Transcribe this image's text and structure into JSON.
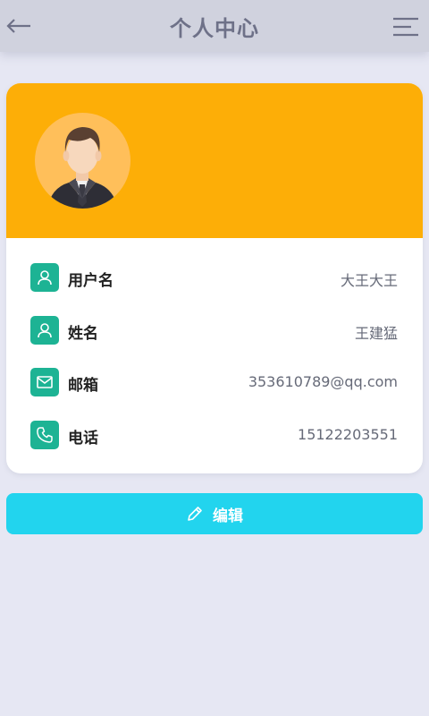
{
  "header": {
    "title": "个人中心",
    "back_icon": "arrow-left-icon",
    "menu_icon": "menu-icon"
  },
  "profile": {
    "banner_color": "#fdae07",
    "avatar_icon": "businessman-avatar",
    "fields": [
      {
        "icon": "user-icon",
        "label": "用户名",
        "value": "大王大王"
      },
      {
        "icon": "user-icon",
        "label": "姓名",
        "value": "王建猛"
      },
      {
        "icon": "mail-icon",
        "label": "邮箱",
        "value": "353610789@qq.com"
      },
      {
        "icon": "phone-icon",
        "label": "电话",
        "value": "15122203551"
      }
    ]
  },
  "actions": {
    "edit_label": "编辑",
    "edit_icon": "pencil-icon",
    "edit_color": "#22d4ee"
  },
  "colors": {
    "accent": "#1db394",
    "background": "#e6e7f3"
  }
}
